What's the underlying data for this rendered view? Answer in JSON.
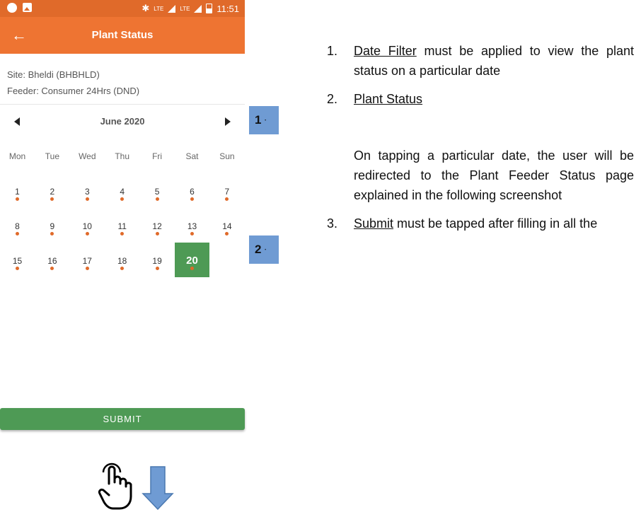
{
  "status_bar": {
    "time": "11:51",
    "lte1": "LTE",
    "lte2": "LTE"
  },
  "app_bar": {
    "title": "Plant Status"
  },
  "info": {
    "site": "Site: Bheldi (BHBHLD)",
    "feeder": "Feeder: Consumer 24Hrs (DND)"
  },
  "calendar": {
    "month": "June 2020",
    "weekdays": [
      "Mon",
      "Tue",
      "Wed",
      "Thu",
      "Fri",
      "Sat",
      "Sun"
    ],
    "days": [
      "1",
      "2",
      "3",
      "4",
      "5",
      "6",
      "7",
      "8",
      "9",
      "10",
      "11",
      "12",
      "13",
      "14",
      "15",
      "16",
      "17",
      "18",
      "19",
      "20"
    ],
    "selected_day": "20"
  },
  "submit_label": "SUBMIT",
  "markers": [
    "1",
    "2"
  ],
  "notes": [
    {
      "num": "1.",
      "title": "Date Filter",
      "text": " must be applied to view the plant status on a particular date"
    },
    {
      "num": "2.",
      "title": "Plant Status",
      "text": ""
    },
    {
      "num": "",
      "title": "",
      "text": "On tapping a particular date, the user will be redirected to the Plant Feeder Status page explained in the following screenshot"
    },
    {
      "num": "3.",
      "title": "Submit",
      "text": " must be tapped after filling in all the"
    }
  ],
  "colors": {
    "primary": "#ee7432",
    "accent_green": "#4e9a55",
    "marker_blue": "#6f9bd3"
  }
}
